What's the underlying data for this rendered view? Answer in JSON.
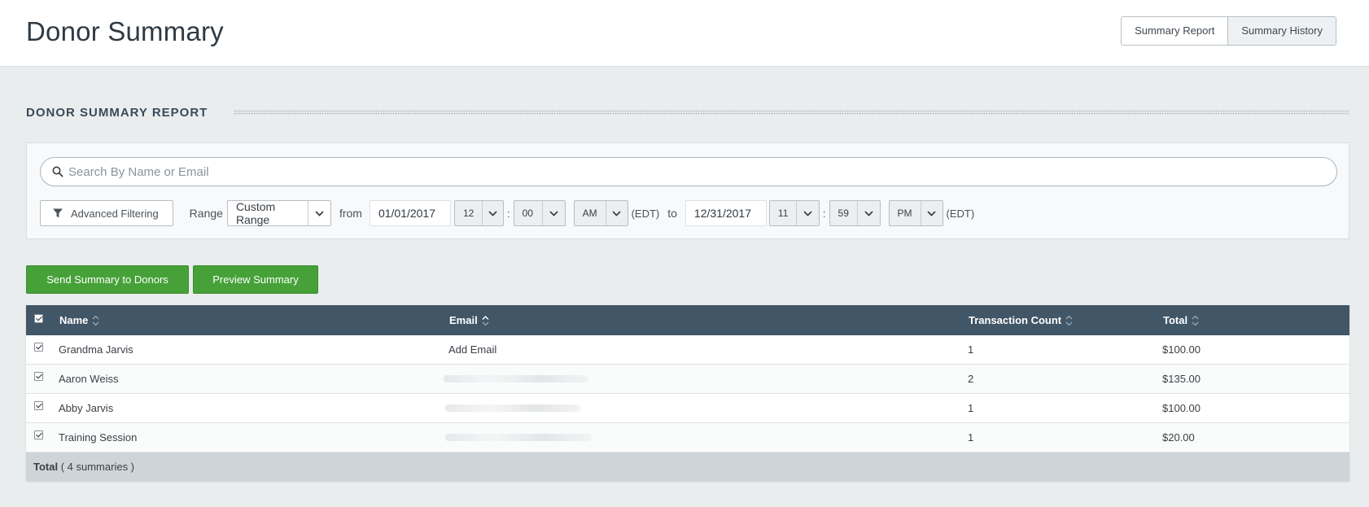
{
  "header": {
    "title": "Donor Summary",
    "tabs": [
      {
        "label": "Summary Report"
      },
      {
        "label": "Summary History"
      }
    ]
  },
  "section": {
    "title": "DONOR SUMMARY REPORT"
  },
  "filters": {
    "search_placeholder": "Search By Name or Email",
    "advanced_label": "Advanced Filtering",
    "range_label": "Range",
    "range_value": "Custom Range",
    "from_label": "from",
    "from_date": "01/01/2017",
    "from_hour": "12",
    "from_minute": "00",
    "from_ampm": "AM",
    "from_tz": "(EDT)",
    "to_label": "to",
    "to_date": "12/31/2017",
    "to_hour": "11",
    "to_minute": "59",
    "to_ampm": "PM",
    "to_tz": "(EDT)",
    "colon": ":"
  },
  "actions": {
    "send_label": "Send Summary to Donors",
    "preview_label": "Preview Summary",
    "accent": "#46a138"
  },
  "table": {
    "header_color": "#415667",
    "columns": {
      "name": "Name",
      "email": "Email",
      "count": "Transaction Count",
      "total": "Total"
    },
    "rows": [
      {
        "name": "Grandma Jarvis",
        "email": "Add Email",
        "count": "1",
        "total": "$100.00"
      },
      {
        "name": "Aaron Weiss",
        "email": "",
        "count": "2",
        "total": "$135.00"
      },
      {
        "name": "Abby Jarvis",
        "email": "",
        "count": "1",
        "total": "$100.00"
      },
      {
        "name": "Training Session",
        "email": "",
        "count": "1",
        "total": "$20.00"
      }
    ],
    "footer": {
      "total_label": "Total",
      "summary_count": "( 4 summaries )"
    }
  }
}
